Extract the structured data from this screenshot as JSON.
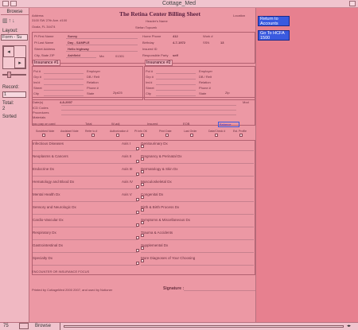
{
  "window": {
    "title": "Cottage_Med"
  },
  "sidebar": {
    "mode_label": "Browse",
    "layout_label": "Layout:",
    "layout_value": "Form - Su",
    "record_label": "Record:",
    "record_value": "1",
    "total_label": "Total:",
    "total_value": "2",
    "sorted_label": "Sorted"
  },
  "form": {
    "title": "The Retina Center Billing Sheet",
    "location_label": "Location",
    "address_label": "Address",
    "address_line1": "3100 SW 27th Ave. #100",
    "address_line2": "Ocala, FL 34474",
    "header_name_label": "Header's Name",
    "header_name_value": "Stefan Topczek",
    "left_labels": [
      "Pt First Name",
      "Pt Last Name",
      "Street Address",
      "City, State ZIP"
    ],
    "left_values": [
      "Sunny",
      "Day - SAMPLE",
      "Hello highway",
      "Ashfield"
    ],
    "state_value": "Ma",
    "zip_value": "01301",
    "right_labels": [
      "Home Phone",
      "Birthday",
      "Work #",
      "SSN",
      "Insured ID",
      "Responsible Party"
    ],
    "right_values": [
      "412",
      "4-7-1972",
      "",
      "13",
      "",
      "self"
    ],
    "insurance1_label": "Insurance #1",
    "insurance2_label": "Insurance #2",
    "ins_fields": [
      "Pol #",
      "Grp #",
      "Ins'd",
      "Street",
      "City"
    ],
    "ins_fields_right": [
      "Employer",
      "DB / Relt",
      "Relation",
      "Phone #",
      "State"
    ],
    "ins_zip_label": "Zip",
    "ins1_zip_value": "425",
    "dates_label": "Date(s)",
    "dates_value": "4-8-2007",
    "mod_label": "Mod",
    "icd_label": "ICD Codes",
    "procedures_label": "Procedures",
    "materials_label": "Materials",
    "totals_row": [
      "you pay on card",
      "Total",
      "W-adj",
      "Insured",
      "EOB",
      "Balance"
    ],
    "visit_row": [
      "Scrubbed Note",
      "Assistant Note",
      "Refer to #",
      "Authorization #",
      "Pt Info OK",
      "Print Date",
      "Last Order",
      "Date/Check #",
      "Est. Profile"
    ],
    "left_diag": [
      "Infectious Diseases",
      "Neoplasms & Cancers",
      "Endocrine Dx",
      "Hematology and Blood Dx",
      "Mental Health Dx",
      "Sensory and Neurologic Dx",
      "Cardio-Vascular Dx",
      "Respiratory Dx",
      "Gastrointestinal Dx",
      "Specialty Dx"
    ],
    "axis_labels": [
      "Axis I",
      "Axis II",
      "Axis III",
      "Axis IV",
      "Axis V"
    ],
    "right_diag": [
      "Genitourinary Dx",
      "Pregnancy & Perinatal Dx",
      "Dermatology & Skin Dx",
      "Musculoskeletal Dx",
      "Congenital Dx",
      "Birth & Birth Process Dx",
      "Symptoms & Miscellaneous Dx",
      "Trauma & Accidents",
      "Supplemental Dx",
      "More Diagnoses of Your Choosing"
    ],
    "footer_note": "ENCOUNTER OR INSURANCE FOCUS",
    "printed_by": "Printed by CottageMed 2000 2007, and used by Notioner",
    "signature_label": "Signature :",
    "return_button": "Return to Accounts",
    "go_button": "Go To HCFA 1500"
  },
  "statusbar": {
    "zoom": "75",
    "mode": "Browse"
  },
  "colors": {
    "page_bg": "#e7808f",
    "form_bg": "#ec98a4",
    "button": "#3a5ae0",
    "link": "#2a2ad0"
  }
}
